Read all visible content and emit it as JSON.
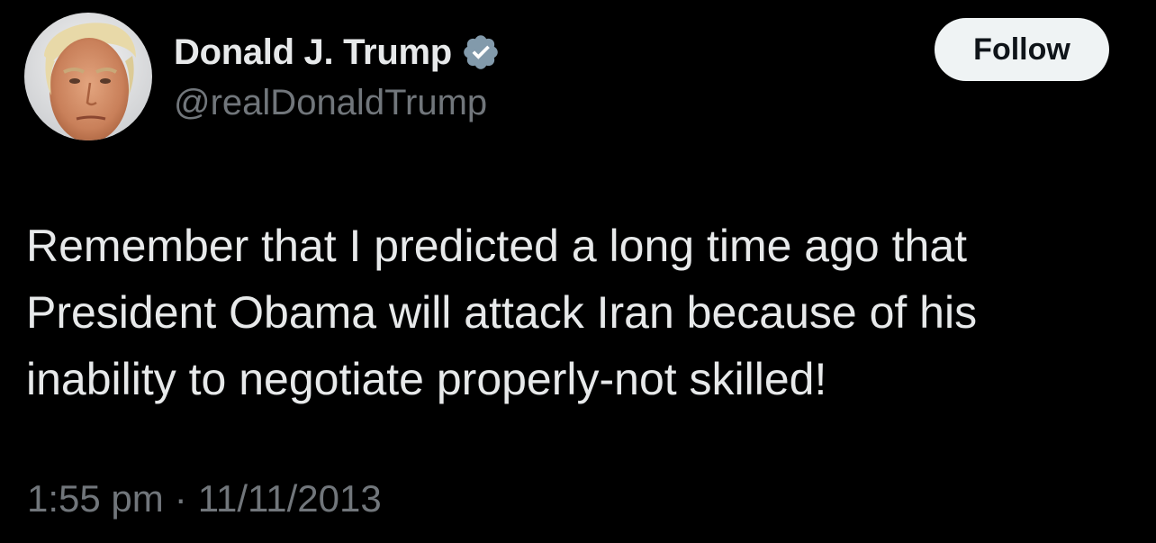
{
  "author": {
    "display_name": "Donald J. Trump",
    "handle": "@realDonaldTrump",
    "verified_icon": "verified-badge-icon",
    "avatar": "profile-photo"
  },
  "follow_button": {
    "label": "Follow"
  },
  "tweet": {
    "lines": [
      "Remember that I predicted a long time ago that",
      "President Obama will attack Iran because of his",
      "inability to negotiate properly-not skilled!"
    ]
  },
  "meta": {
    "time": "1:55 pm",
    "separator": "·",
    "date": "11/11/2013"
  },
  "colors": {
    "background": "#000000",
    "primary_text": "#e7e9ea",
    "secondary_text": "#71767b",
    "verified_badge": "#829aab",
    "follow_bg": "#eff3f4",
    "follow_text": "#0f1419"
  }
}
